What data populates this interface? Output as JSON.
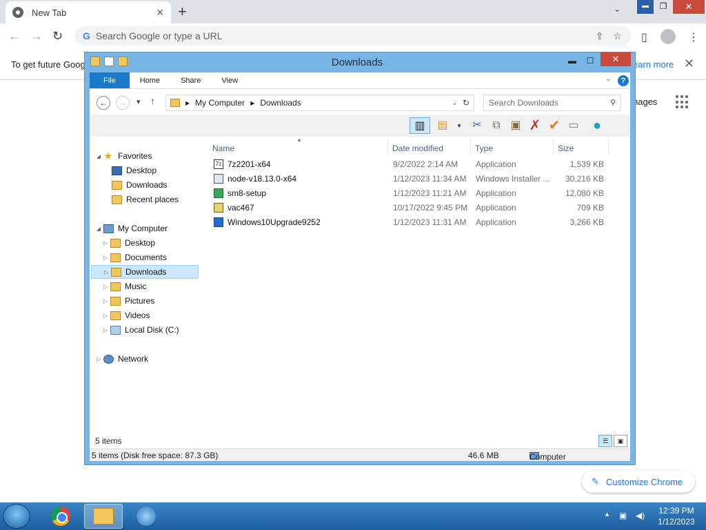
{
  "chrome": {
    "tab_title": "New Tab",
    "omnibox_placeholder": "Search Google or type a URL",
    "infobar_text": "To get future Goog",
    "infobar_link": "earn more",
    "images_link": "nages",
    "customize_label": "Customize Chrome"
  },
  "explorer": {
    "title": "Downloads",
    "ribbon_tabs": [
      "File",
      "Home",
      "Share",
      "View"
    ],
    "breadcrumb": [
      "My Computer",
      "Downloads"
    ],
    "search_placeholder": "Search Downloads",
    "nav": {
      "favorites": "Favorites",
      "fav_items": [
        "Desktop",
        "Downloads",
        "Recent places"
      ],
      "computer": "My Computer",
      "computer_items": [
        "Desktop",
        "Documents",
        "Downloads",
        "Music",
        "Pictures",
        "Videos",
        "Local Disk (C:)"
      ],
      "network": "Network"
    },
    "columns": [
      "Name",
      "Date modified",
      "Type",
      "Size"
    ],
    "files": [
      {
        "name": "7z2201-x64",
        "date": "9/2/2022 2:14 AM",
        "type": "Application",
        "size": "1,539 KB"
      },
      {
        "name": "node-v18.13.0-x64",
        "date": "1/12/2023 11:34 AM",
        "type": "Windows Installer ...",
        "size": "30,216 KB"
      },
      {
        "name": "sm8-setup",
        "date": "1/12/2023 11:21 AM",
        "type": "Application",
        "size": "12,080 KB"
      },
      {
        "name": "vac467",
        "date": "10/17/2022 9:45 PM",
        "type": "Application",
        "size": "709 KB"
      },
      {
        "name": "Windows10Upgrade9252",
        "date": "1/12/2023 11:31 AM",
        "type": "Application",
        "size": "3,266 KB"
      }
    ],
    "item_count": "5 items",
    "status_left": "5 items (Disk free space: 87.3 GB)",
    "status_size": "46.6 MB",
    "status_location": "Computer"
  },
  "taskbar": {
    "time": "12:39 PM",
    "date": "1/12/2023"
  }
}
